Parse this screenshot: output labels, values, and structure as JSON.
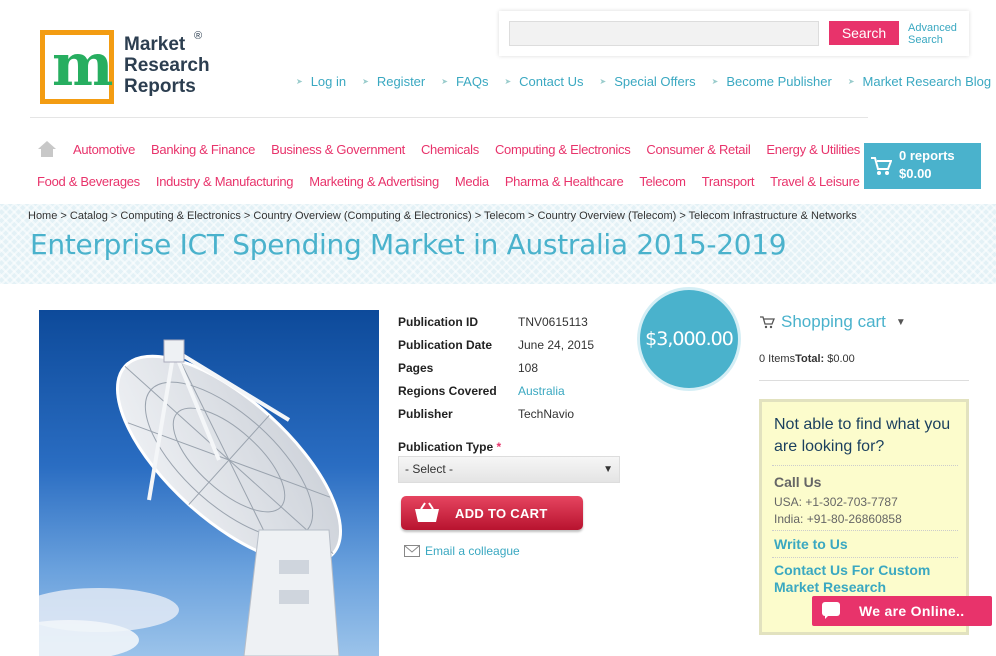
{
  "logo": {
    "line1": "Market",
    "line2": "Research",
    "line3": "Reports",
    "registered": "®"
  },
  "search": {
    "placeholder": "",
    "button_label": "Search",
    "advanced_line1": "Advanced",
    "advanced_line2": "Search"
  },
  "top_links": [
    "Log in",
    "Register",
    "FAQs",
    "Contact Us",
    "Special Offers",
    "Become Publisher",
    "Market Research Blog"
  ],
  "categories_row1": [
    "Automotive",
    "Banking & Finance",
    "Business & Government",
    "Chemicals",
    "Computing & Electronics",
    "Consumer & Retail",
    "Energy & Utilities"
  ],
  "categories_row2": [
    "Food & Beverages",
    "Industry & Manufacturing",
    "Marketing & Advertising",
    "Media",
    "Pharma & Healthcare",
    "Telecom",
    "Transport",
    "Travel & Leisure"
  ],
  "cart_button": {
    "reports": "0 reports",
    "amount": "$0.00"
  },
  "breadcrumb": [
    "Home",
    "Catalog",
    "Computing & Electronics",
    "Country Overview (Computing & Electronics)",
    "Telecom",
    "Country Overview (Telecom)",
    "Telecom Infrastructure & Networks"
  ],
  "breadcrumb_sep": ">",
  "page_title": "Enterprise ICT Spending Market in Australia 2015-2019",
  "product": {
    "rows": [
      {
        "label": "Publication ID",
        "value": "TNV0615113"
      },
      {
        "label": "Publication Date",
        "value": "June 24, 2015"
      },
      {
        "label": "Pages",
        "value": "108"
      },
      {
        "label": "Regions Covered",
        "value": "Australia"
      },
      {
        "label": "Publisher",
        "value": "TechNavio"
      }
    ],
    "price": "$3,000.00",
    "publication_type_label": "Publication Type",
    "required_mark": "*",
    "publication_type_selected": "- Select -",
    "add_to_cart_label": "ADD TO CART",
    "email_label": "Email a colleague"
  },
  "sidebar": {
    "shopping_cart_title": "Shopping cart",
    "items_text": "0 Items",
    "total_label": "Total:",
    "total_value": "$0.00",
    "help_question": "Not able to find what you are looking for?",
    "call_us": "Call Us",
    "phone_usa": "USA: +1-302-703-7787",
    "phone_india": "India: +91-80-26860858",
    "write_to_us": "Write to Us",
    "contact_custom": "Contact Us For Custom Market Research"
  },
  "chat": {
    "label": "We are Online.."
  },
  "colors": {
    "accent_blue": "#4ab2cc",
    "accent_pink": "#e8336b"
  }
}
